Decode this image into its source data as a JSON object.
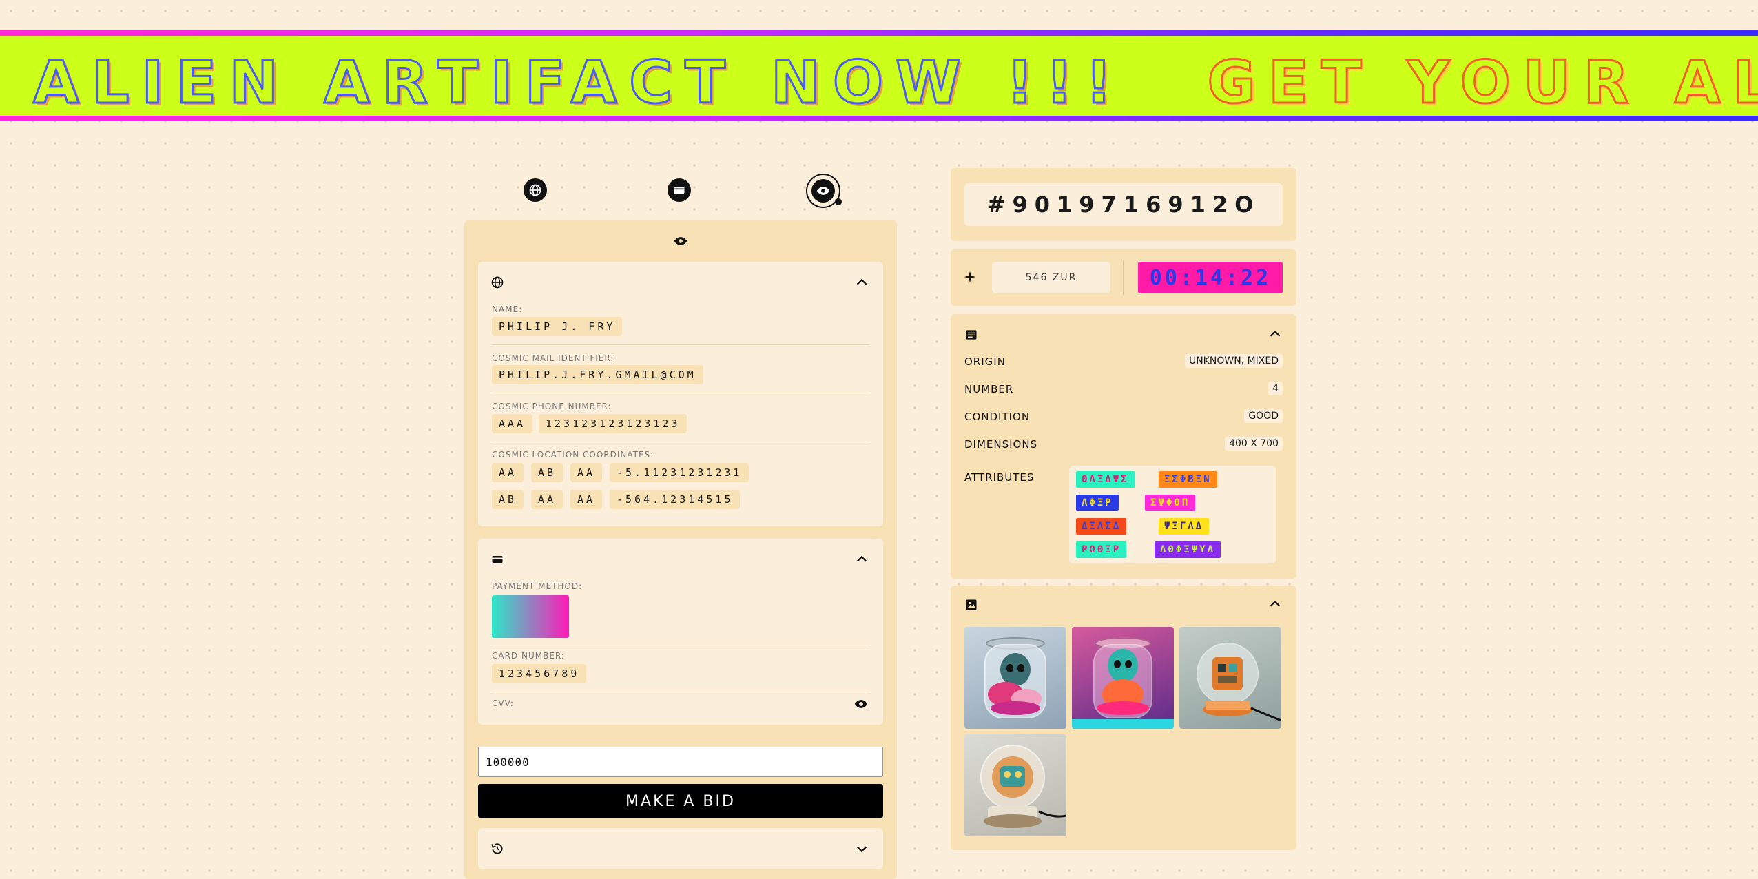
{
  "banner": {
    "segments": [
      "R ALIEN ARTIFACT NOW !!!",
      "GET YOUR ALIEN ARTIFACT N"
    ]
  },
  "steps": [
    {
      "icon": "globe-icon"
    },
    {
      "icon": "credit-card-icon"
    },
    {
      "icon": "eye-icon",
      "active": true
    }
  ],
  "personal": {
    "name_label": "NAME:",
    "name_value": "PHILIP J. FRY",
    "mail_label": "COSMIC MAIL IDENTIFIER:",
    "mail_value": "PHILIP.J.FRY.GMAIL@COM",
    "phone_label": "COSMIC PHONE NUMBER:",
    "phone_prefix": "AAA",
    "phone_value": "123123123123123",
    "location_label": "COSMIC LOCATION COORDINATES:",
    "coord_row_1": [
      "AA",
      "AB",
      "AA",
      "-5.11231231231"
    ],
    "coord_row_2": [
      "AB",
      "AA",
      "AA",
      "-564.12314515"
    ]
  },
  "payment": {
    "method_label": "PAYMENT METHOD:",
    "card_number_label": "CARD NUMBER:",
    "card_number_value": "123456789",
    "cvv_label": "CVV:"
  },
  "bid": {
    "input_value": "100000",
    "button_label": "MAKE A BID"
  },
  "artifact": {
    "id": "#9019716912O",
    "price": "546 ZUR",
    "timer": "00:14:22",
    "details": [
      {
        "label": "ORIGIN",
        "value": "UNKNOWN, MIXED"
      },
      {
        "label": "NUMBER",
        "value": "4"
      },
      {
        "label": "CONDITION",
        "value": "GOOD"
      },
      {
        "label": "DIMENSIONS",
        "value": "400 X 700"
      }
    ],
    "attributes_label": "ATTRIBUTES",
    "attributes": [
      {
        "text": "ΘΛΞΔΨΣ",
        "bg": "#2bf0c0",
        "fg": "#e0207a"
      },
      {
        "text": "ΞΣΦΒΞΝ",
        "bg": "#ff8a1a",
        "fg": "#3a40e0"
      },
      {
        "text": "ΛΦΞΡ",
        "bg": "#2b3ae8",
        "fg": "#f5e020"
      },
      {
        "text": "ΣΨΦΘΠ",
        "bg": "#ff2bd6",
        "fg": "#f5e020"
      },
      {
        "text": "ΔΞΛΣΔ",
        "bg": "#f24a1a",
        "fg": "#2b40e8"
      },
      {
        "text": "ΨΞΓΛΔ",
        "bg": "#ffe01a",
        "fg": "#3a2b8a"
      },
      {
        "text": "ΡΩΘΞΡ",
        "bg": "#2bf0c0",
        "fg": "#e0207a"
      },
      {
        "text": "ΛΘΦΞΨΥΛ",
        "bg": "#8a2bf0",
        "fg": "#c8f04a"
      }
    ],
    "images": [
      {
        "name": "alien-in-jar-1"
      },
      {
        "name": "alien-in-jar-2"
      },
      {
        "name": "robot-in-dome-1"
      },
      {
        "name": "robot-in-dome-2"
      }
    ]
  },
  "colors": {
    "accent_lime": "#ccff1a",
    "timer_bg": "#ff1aa8",
    "timer_fg": "#2b3ae8",
    "panel": "#f7e1b5",
    "page": "#fbefdc"
  }
}
